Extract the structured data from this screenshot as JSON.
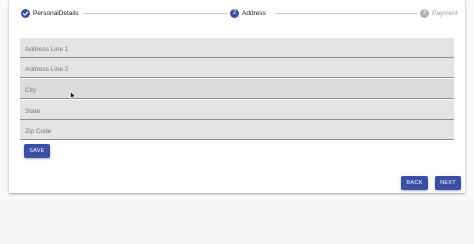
{
  "stepper": {
    "steps": [
      {
        "label": "PersonalDetails",
        "number": "",
        "state": "completed"
      },
      {
        "label": "Address",
        "number": "2",
        "state": "active"
      },
      {
        "label": "Payment",
        "number": "3",
        "state": "pending"
      }
    ]
  },
  "form": {
    "fields": [
      {
        "placeholder": "Address Line 1",
        "value": ""
      },
      {
        "placeholder": "Address Line 2",
        "value": ""
      },
      {
        "placeholder": "City",
        "value": ""
      },
      {
        "placeholder": "State",
        "value": ""
      },
      {
        "placeholder": "Zip Code",
        "value": ""
      }
    ],
    "save_label": "SAVE"
  },
  "navigation": {
    "back_label": "BACK",
    "next_label": "NEXT"
  },
  "colors": {
    "primary": "#3c4fa6",
    "pending": "#b0b0b0"
  }
}
